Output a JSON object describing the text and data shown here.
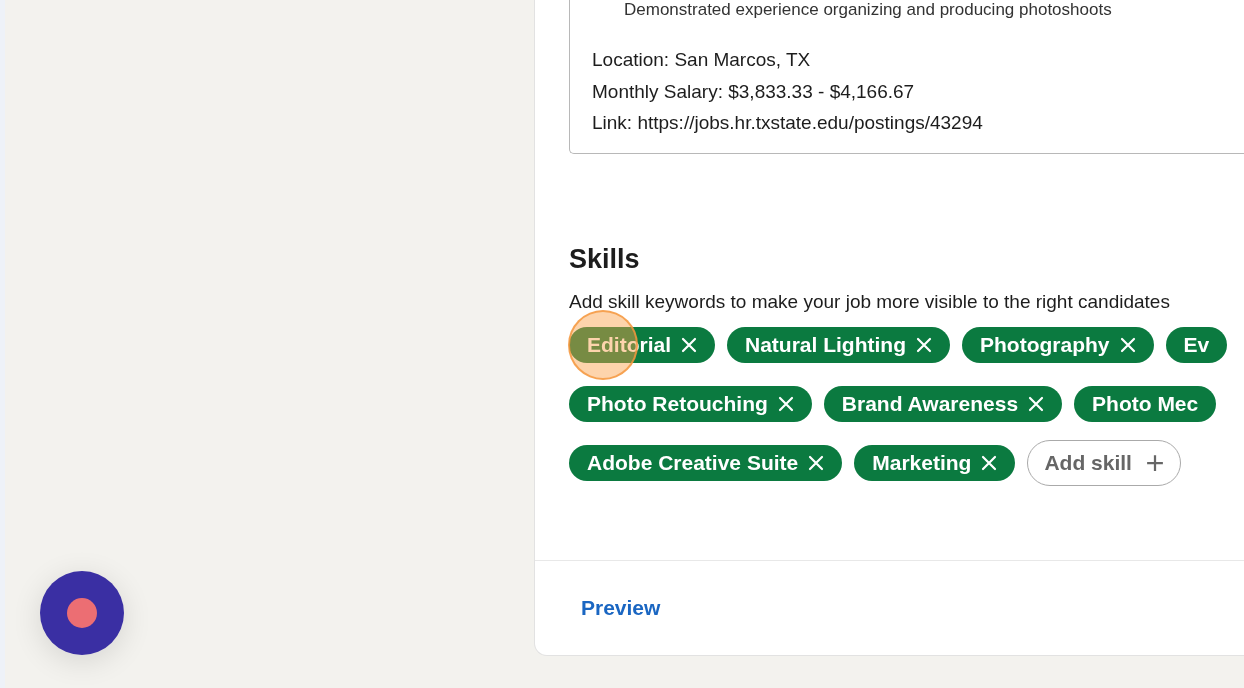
{
  "description_box": {
    "lines": [
      "Demonstrated experience organizing and producing photoshoots",
      "Location: San Marcos, TX",
      "Monthly Salary: $3,833.33 - $4,166.67",
      "Link: https://jobs.hr.txstate.edu/postings/43294"
    ]
  },
  "skills": {
    "title": "Skills",
    "hint": "Add skill keywords to make your job more visible to the right candidates",
    "rows": [
      {
        "chips": [
          {
            "label": "Editorial",
            "removable": true,
            "highlighted": true
          },
          {
            "label": "Natural Lighting",
            "removable": true,
            "highlighted": false
          },
          {
            "label": "Photography",
            "removable": true,
            "highlighted": false
          },
          {
            "label": "Ev",
            "removable": false,
            "highlighted": false
          }
        ]
      },
      {
        "chips": [
          {
            "label": "Photo Retouching",
            "removable": true,
            "highlighted": false
          },
          {
            "label": "Brand Awareness",
            "removable": true,
            "highlighted": false
          },
          {
            "label": "Photo Mec",
            "removable": false,
            "highlighted": false
          }
        ]
      },
      {
        "chips": [
          {
            "label": "Adobe Creative Suite",
            "removable": true,
            "highlighted": false
          },
          {
            "label": "Marketing",
            "removable": true,
            "highlighted": false
          }
        ]
      }
    ],
    "add_button": "Add skill"
  },
  "footer": {
    "preview": "Preview"
  },
  "recorder": {
    "recording": true
  }
}
